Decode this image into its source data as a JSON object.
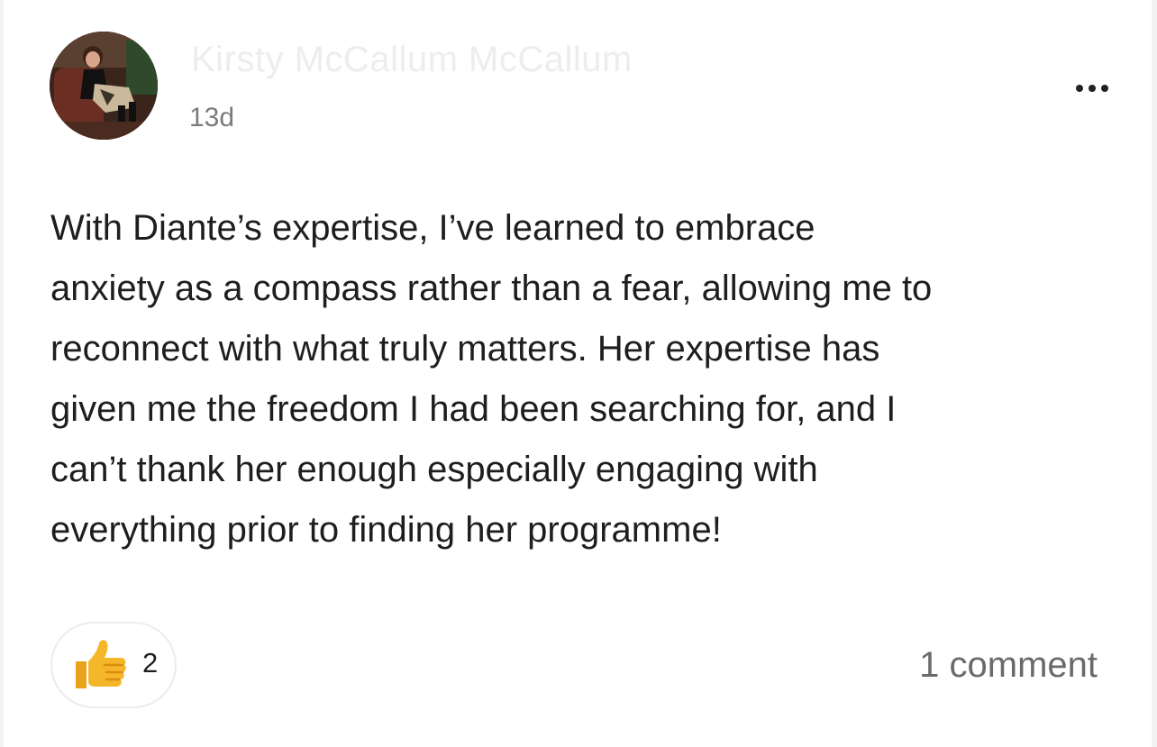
{
  "post": {
    "author_name": "Kirsty McCallum McCallum",
    "timestamp": "13d",
    "more_icon": "more-horizontal-icon",
    "body_lines": [
      "With Diante’s expertise, I’ve learned to embrace",
      "anxiety as a compass rather than a fear, allowing me to",
      "reconnect with what truly matters. Her expertise has",
      "given me the freedom I had been searching for, and I",
      "can’t thank her enough especially engaging with",
      "everything prior to finding her programme!"
    ]
  },
  "reactions": {
    "icon": "thumbs-up-icon",
    "count": "2"
  },
  "comments": {
    "label": "1 comment"
  },
  "colors": {
    "text": "#1e1e1e",
    "muted": "#7b7b7b",
    "thumb": "#f5b72a"
  }
}
